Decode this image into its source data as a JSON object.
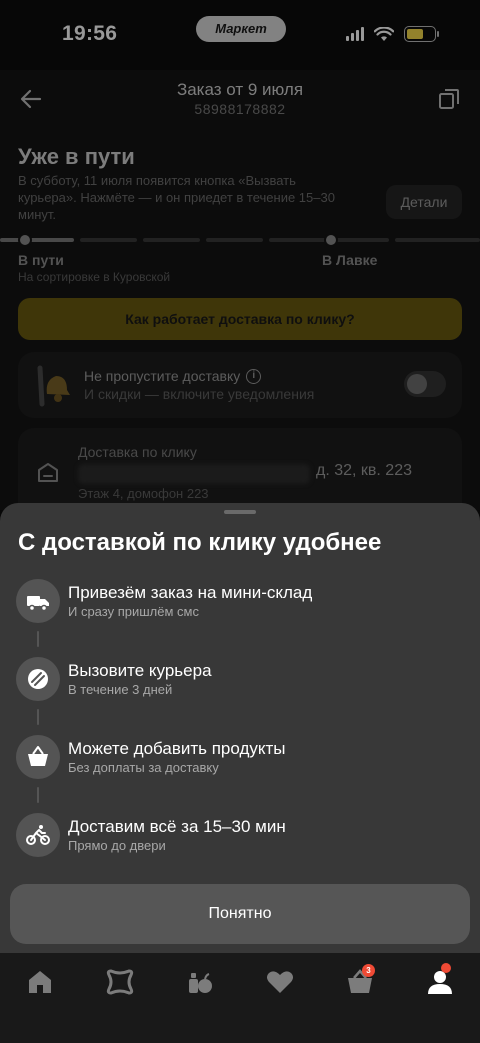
{
  "status_bar": {
    "time": "19:56",
    "center_badge": "Маркет"
  },
  "header": {
    "title": "Заказ от 9 июля",
    "order_number": "58988178882"
  },
  "order_status": {
    "title": "Уже в пути",
    "description": "В субботу, 11 июля появится кнопка «Вызвать курьера». Нажмёте — и он приедет в течение 15–30 минут.",
    "details_button": "Детали"
  },
  "progress": {
    "step_current": "В пути",
    "step_current_sub": "На сортировке в Куровской",
    "step_next": "В Лавке"
  },
  "how_it_works_button": "Как работает доставка по клику?",
  "notification_card": {
    "title": "Не пропустите доставку",
    "subtitle": "И скидки — включите уведомления",
    "toggle_on": false
  },
  "delivery_card": {
    "label": "Доставка по клику",
    "address_visible_part": "д. 32, кв. 223",
    "floor_info": "Этаж 4, домофон 223"
  },
  "sheet": {
    "title": "С доставкой по клику удобнее",
    "features": [
      {
        "icon": "truck-icon",
        "title": "Привезём заказ на мини-склад",
        "subtitle": "И сразу пришлём смс"
      },
      {
        "icon": "courier-call-icon",
        "title": "Вызовите курьера",
        "subtitle": "В течение 3 дней"
      },
      {
        "icon": "basket-icon",
        "title": "Можете добавить продукты",
        "subtitle": "Без доплаты за доставку"
      },
      {
        "icon": "cyclist-icon",
        "title": "Доставим всё за 15–30 мин",
        "subtitle": "Прямо до двери"
      }
    ],
    "ok_button": "Понятно"
  },
  "tabbar": {
    "tabs": [
      "home-icon",
      "catalog-icon",
      "grocery-icon",
      "favorites-icon",
      "cart-icon",
      "profile-icon"
    ],
    "cart_badge": "3"
  },
  "colors": {
    "sheet_bg": "#383838",
    "accent_yellow": "#6a5b0f",
    "badge_red": "#ef4a35"
  }
}
